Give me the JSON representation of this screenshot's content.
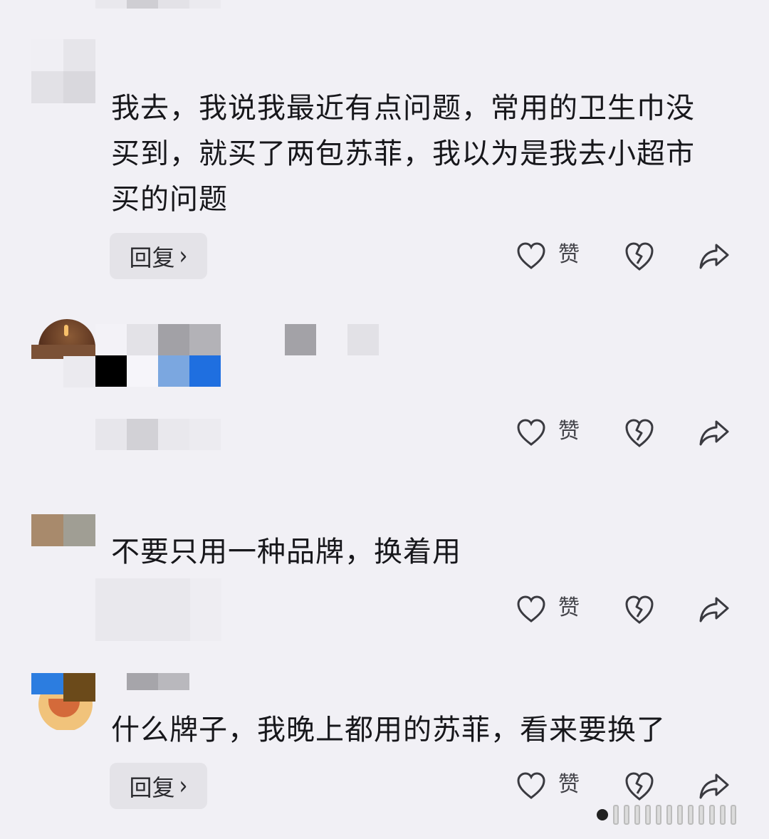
{
  "comments": [
    {
      "text": "我去，我说我最近有点问题，常用的卫生巾没买到，就买了两包苏菲，我以为是我去小超市买的问题",
      "reply_label": "回复",
      "like_label": "赞"
    },
    {
      "text": "",
      "like_label": "赞"
    },
    {
      "text": "不要只用一种品牌，换着用",
      "like_label": "赞"
    },
    {
      "text": "什么牌子，我晚上都用的苏菲，看来要换了",
      "reply_label": "回复",
      "like_label": "赞"
    }
  ],
  "icons": {
    "like": "heart-icon",
    "dislike": "broken-heart-icon",
    "share": "share-arrow-icon",
    "reply_chevron": "chevron-right-icon"
  },
  "colors": {
    "background": "#f1f0f5",
    "reply_button": "#e4e3e8",
    "text": "#17171b",
    "icon": "#3a3a40"
  }
}
